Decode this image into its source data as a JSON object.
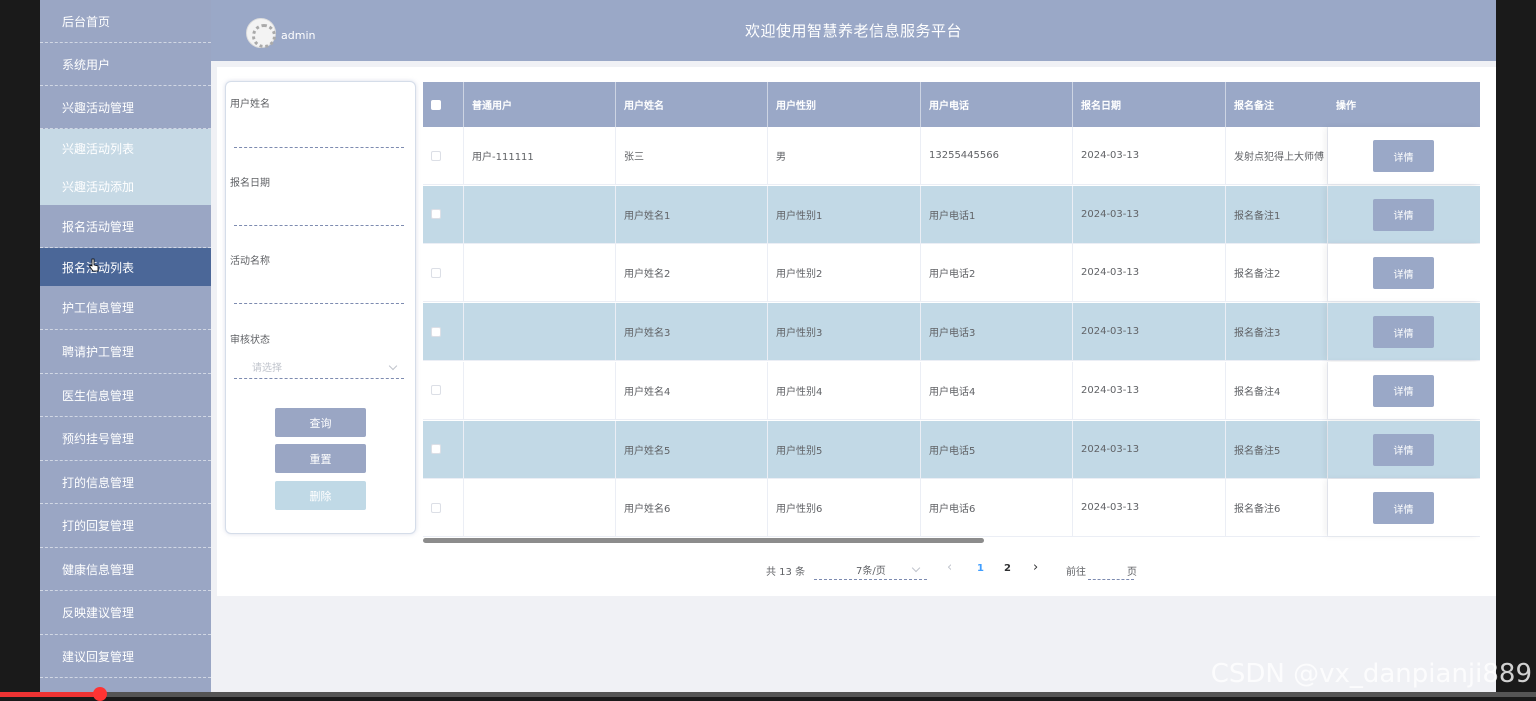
{
  "sidebar": {
    "items": [
      {
        "label": "后台首页"
      },
      {
        "label": "系统用户"
      },
      {
        "label": "兴趣活动管理"
      },
      {
        "label": "兴趣活动列表"
      },
      {
        "label": "兴趣活动添加"
      },
      {
        "label": "报名活动管理"
      },
      {
        "label": "报名活动列表"
      },
      {
        "label": "护工信息管理"
      },
      {
        "label": "聘请护工管理"
      },
      {
        "label": "医生信息管理"
      },
      {
        "label": "预约挂号管理"
      },
      {
        "label": "打的信息管理"
      },
      {
        "label": "打的回复管理"
      },
      {
        "label": "健康信息管理"
      },
      {
        "label": "反映建议管理"
      },
      {
        "label": "建议回复管理"
      }
    ]
  },
  "header": {
    "username": "admin",
    "title": "欢迎使用智慧养老信息服务平台"
  },
  "filter": {
    "user_name_label": "用户姓名",
    "signup_date_label": "报名日期",
    "activity_name_label": "活动名称",
    "review_status_label": "审核状态",
    "review_status_placeholder": "请选择",
    "query_label": "查询",
    "reset_label": "重置",
    "delete_label": "删除"
  },
  "table": {
    "columns": [
      "普通用户",
      "用户姓名",
      "用户性别",
      "用户电话",
      "报名日期",
      "报名备注",
      "操作"
    ],
    "rows": [
      {
        "user": "用户-111111",
        "name": "张三",
        "gender": "男",
        "phone": "13255445566",
        "date": "2024-03-13",
        "note": "发射点犯得上大师傅",
        "action": "详情"
      },
      {
        "user": "",
        "name": "用户姓名1",
        "gender": "用户性别1",
        "phone": "用户电话1",
        "date": "2024-03-13",
        "note": "报名备注1",
        "action": "详情"
      },
      {
        "user": "",
        "name": "用户姓名2",
        "gender": "用户性别2",
        "phone": "用户电话2",
        "date": "2024-03-13",
        "note": "报名备注2",
        "action": "详情"
      },
      {
        "user": "",
        "name": "用户姓名3",
        "gender": "用户性别3",
        "phone": "用户电话3",
        "date": "2024-03-13",
        "note": "报名备注3",
        "action": "详情"
      },
      {
        "user": "",
        "name": "用户姓名4",
        "gender": "用户性别4",
        "phone": "用户电话4",
        "date": "2024-03-13",
        "note": "报名备注4",
        "action": "详情"
      },
      {
        "user": "",
        "name": "用户姓名5",
        "gender": "用户性别5",
        "phone": "用户电话5",
        "date": "2024-03-13",
        "note": "报名备注5",
        "action": "详情"
      },
      {
        "user": "",
        "name": "用户姓名6",
        "gender": "用户性别6",
        "phone": "用户电话6",
        "date": "2024-03-13",
        "note": "报名备注6",
        "action": "详情"
      }
    ]
  },
  "pagination": {
    "total": "共 13 条",
    "page_size": "7条/页",
    "prev": "‹",
    "pages": [
      "1",
      "2"
    ],
    "next": "›",
    "goto_prefix": "前往",
    "goto_suffix": "页",
    "current_page": 1
  },
  "watermark": "CSDN @vx_danpianji889",
  "video_progress": 0.065,
  "colors": {
    "sidebar": "#9aa6c4",
    "sidebar_active": "#4b6798",
    "header": "#9aa8c7",
    "row_striped": "#c2d9e6",
    "pager_active": "#409eff"
  }
}
